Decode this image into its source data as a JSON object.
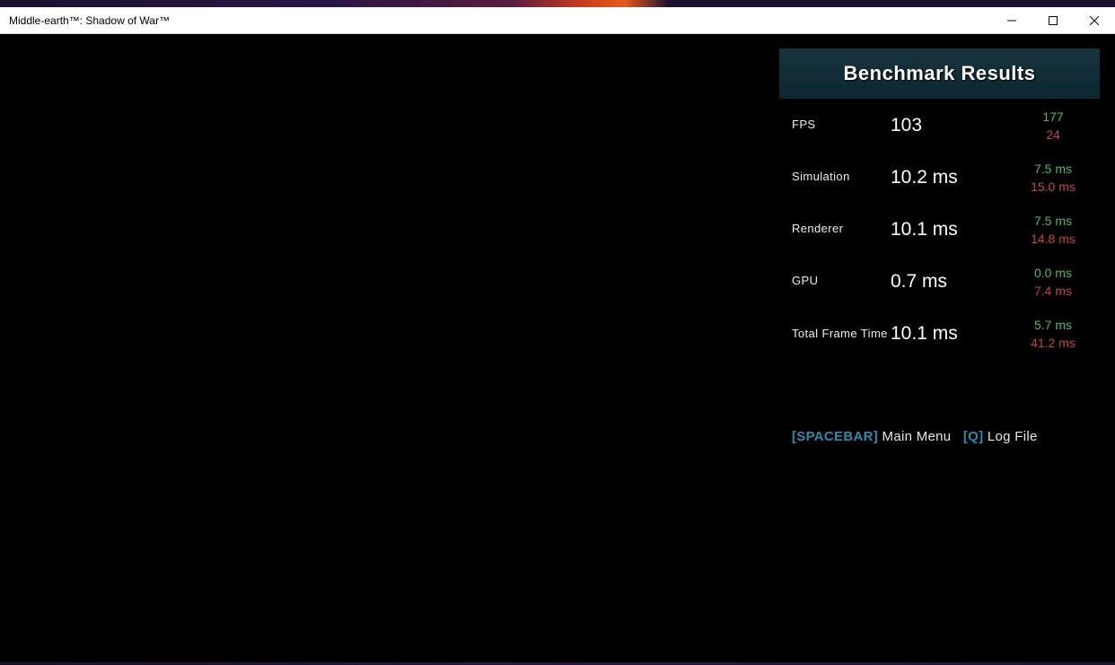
{
  "window": {
    "title": "Middle-earth™: Shadow of War™"
  },
  "panel": {
    "title": "Benchmark Results"
  },
  "rows": [
    {
      "label": "FPS",
      "value": "103",
      "hi": "177",
      "lo": "24"
    },
    {
      "label": "Simulation",
      "value": "10.2 ms",
      "hi": "7.5 ms",
      "lo": "15.0 ms"
    },
    {
      "label": "Renderer",
      "value": "10.1 ms",
      "hi": "7.5 ms",
      "lo": "14.8 ms"
    },
    {
      "label": "GPU",
      "value": "0.7 ms",
      "hi": "0.0 ms",
      "lo": "7.4 ms"
    },
    {
      "label": "Total Frame Time",
      "value": "10.1 ms",
      "hi": "5.7 ms",
      "lo": "41.2 ms"
    }
  ],
  "hints": {
    "key1": "[SPACEBAR]",
    "act1": "Main Menu",
    "key2": "[Q]",
    "act2": "Log File"
  }
}
